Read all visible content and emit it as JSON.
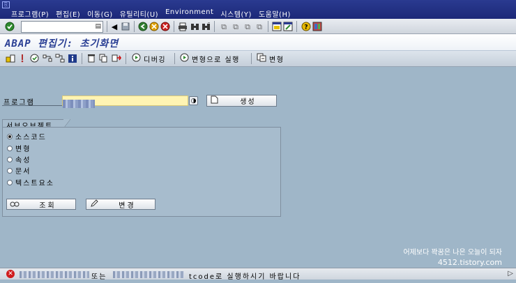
{
  "menu": {
    "items": [
      "프로그램(P)",
      "편집(E)",
      "이동(G)",
      "유틸리티(U)",
      "Environment",
      "시스템(Y)",
      "도움말(H)"
    ]
  },
  "toolbar": {
    "command_field": "",
    "icons": [
      "enter-icon",
      "dropdown-icon",
      "back-icon",
      "save-icon",
      "back-green-icon",
      "exit-icon",
      "cancel-icon",
      "print-icon",
      "find-icon",
      "find-next-icon",
      "first-page-icon",
      "prev-page-icon",
      "next-page-icon",
      "last-page-icon",
      "new-session-icon",
      "shortcut-icon",
      "help-icon",
      "layout-icon"
    ]
  },
  "title": "ABAP 편집기: 초기화면",
  "app_toolbar": {
    "debug_label": "디버깅",
    "run_variant_label": "변형으로 실행",
    "variant_label": "변형"
  },
  "program": {
    "label": "프로그램",
    "value": "",
    "create_label": "생성"
  },
  "subobjects": {
    "title": "서브오브젝트",
    "options": [
      {
        "label": "소스코드",
        "selected": true
      },
      {
        "label": "변형",
        "selected": false
      },
      {
        "label": "속성",
        "selected": false
      },
      {
        "label": "문서",
        "selected": false
      },
      {
        "label": "텍스트요소",
        "selected": false
      }
    ],
    "display_label": "조회",
    "change_label": "변경"
  },
  "watermark": {
    "line1": "어제보다 꽉꿈은 나은 오늘이 되자",
    "line2": "4512.tistory.com"
  },
  "status": {
    "text_mid": "또는",
    "text_end": "tcode로 실행하시기 바랍니다"
  },
  "colors": {
    "menubar": "#1c2878",
    "background": "#9fb6c8",
    "title_text": "#2a3f94",
    "input_required": "#fff4b3",
    "error": "#d01c1c"
  }
}
